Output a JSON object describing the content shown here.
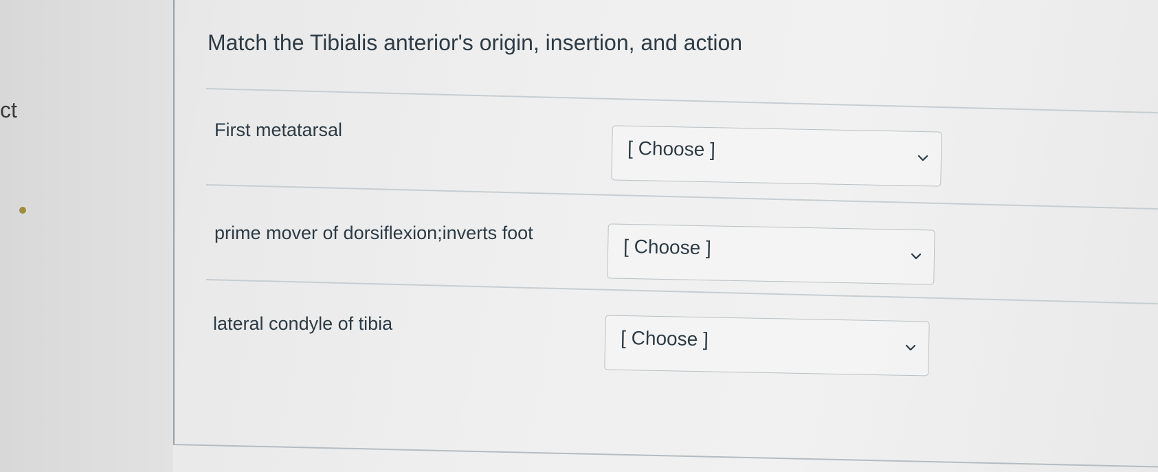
{
  "question": {
    "title": "Match the Tibialis anterior's origin, insertion, and action"
  },
  "left_panel": {
    "text": "ct"
  },
  "rows": [
    {
      "label": "First metatarsal",
      "select": {
        "value": "[ Choose ]",
        "icon": "chevron-down-icon"
      }
    },
    {
      "label": "prime mover of dorsiflexion;inverts foot",
      "select": {
        "value": "[ Choose ]",
        "icon": "chevron-down-icon"
      }
    },
    {
      "label": "lateral condyle of tibia",
      "select": {
        "value": "[ Choose ]",
        "icon": "chevron-down-icon"
      }
    }
  ]
}
